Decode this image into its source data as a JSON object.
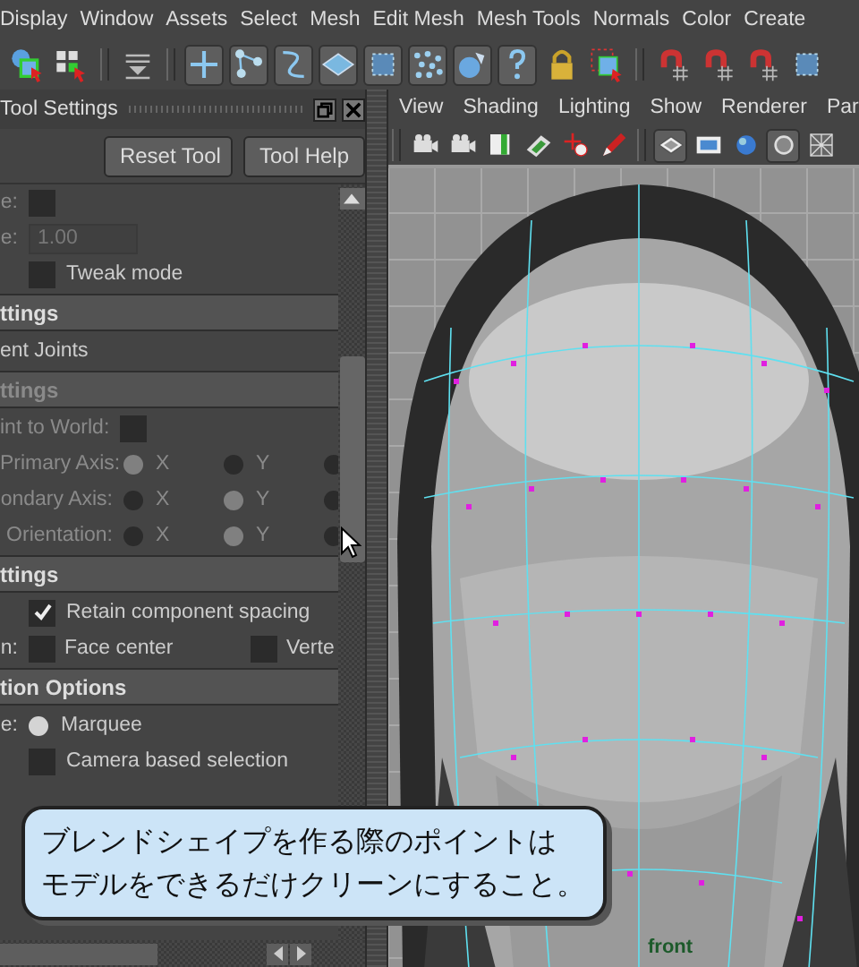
{
  "menu_bar": [
    "Display",
    "Window",
    "Assets",
    "Select",
    "Mesh",
    "Edit Mesh",
    "Mesh Tools",
    "Normals",
    "Color",
    "Create"
  ],
  "tool_settings": {
    "title": "Tool Settings",
    "buttons": [
      "Reset Tool",
      "Tool Help"
    ],
    "rows": [
      {
        "kind": "checkbox",
        "label": "e:",
        "checked": false,
        "disabled": true
      },
      {
        "kind": "field",
        "label": "e:",
        "value": "1.00",
        "disabled": true
      },
      {
        "kind": "checkbox",
        "text": "Tweak mode",
        "checked": false,
        "disabled": false
      },
      {
        "kind": "header",
        "text": "ttings",
        "disabled": false
      },
      {
        "kind": "item",
        "text": "ent Joints",
        "disabled": false
      },
      {
        "kind": "header",
        "text": "ttings",
        "disabled": true
      },
      {
        "kind": "checkbox",
        "label": "int to World:",
        "checked": false,
        "disabled": true
      },
      {
        "kind": "radios",
        "label": "Primary Axis:",
        "disabled": true,
        "options": [
          {
            "text": "X",
            "selected": true
          },
          {
            "text": "Y",
            "selected": false
          },
          {
            "selected": false
          }
        ]
      },
      {
        "kind": "radios",
        "label": "ondary Axis:",
        "disabled": true,
        "options": [
          {
            "text": "X",
            "selected": false
          },
          {
            "text": "Y",
            "selected": true
          },
          {
            "selected": false
          }
        ]
      },
      {
        "kind": "radios",
        "label": "Orientation:",
        "disabled": true,
        "options": [
          {
            "text": "X",
            "selected": false
          },
          {
            "text": "Y",
            "selected": true
          },
          {
            "selected": false
          }
        ]
      },
      {
        "kind": "header",
        "text": "ttings",
        "disabled": false
      },
      {
        "kind": "checkbox",
        "text": "Retain component spacing",
        "checked": true,
        "disabled": false
      },
      {
        "kind": "checkboxes",
        "label": "n:",
        "disabled": false,
        "options": [
          {
            "text": "Face center",
            "checked": false
          },
          {
            "text": "Verte",
            "checked": false
          }
        ]
      },
      {
        "kind": "header",
        "text": "tion Options",
        "disabled": false
      },
      {
        "kind": "radios",
        "label": "e:",
        "disabled": false,
        "options": [
          {
            "text": "Marquee",
            "selected": true
          }
        ]
      },
      {
        "kind": "checkbox",
        "text": "Camera based selection",
        "checked": false,
        "disabled": false
      }
    ]
  },
  "viewport": {
    "menu": [
      "View",
      "Shading",
      "Lighting",
      "Show",
      "Renderer",
      "Par"
    ],
    "camera_label": "front"
  },
  "callout": {
    "lines": [
      "ブレンドシェイプを作る際のポイントは",
      "モデルをできるだけクリーンにすること。"
    ]
  }
}
